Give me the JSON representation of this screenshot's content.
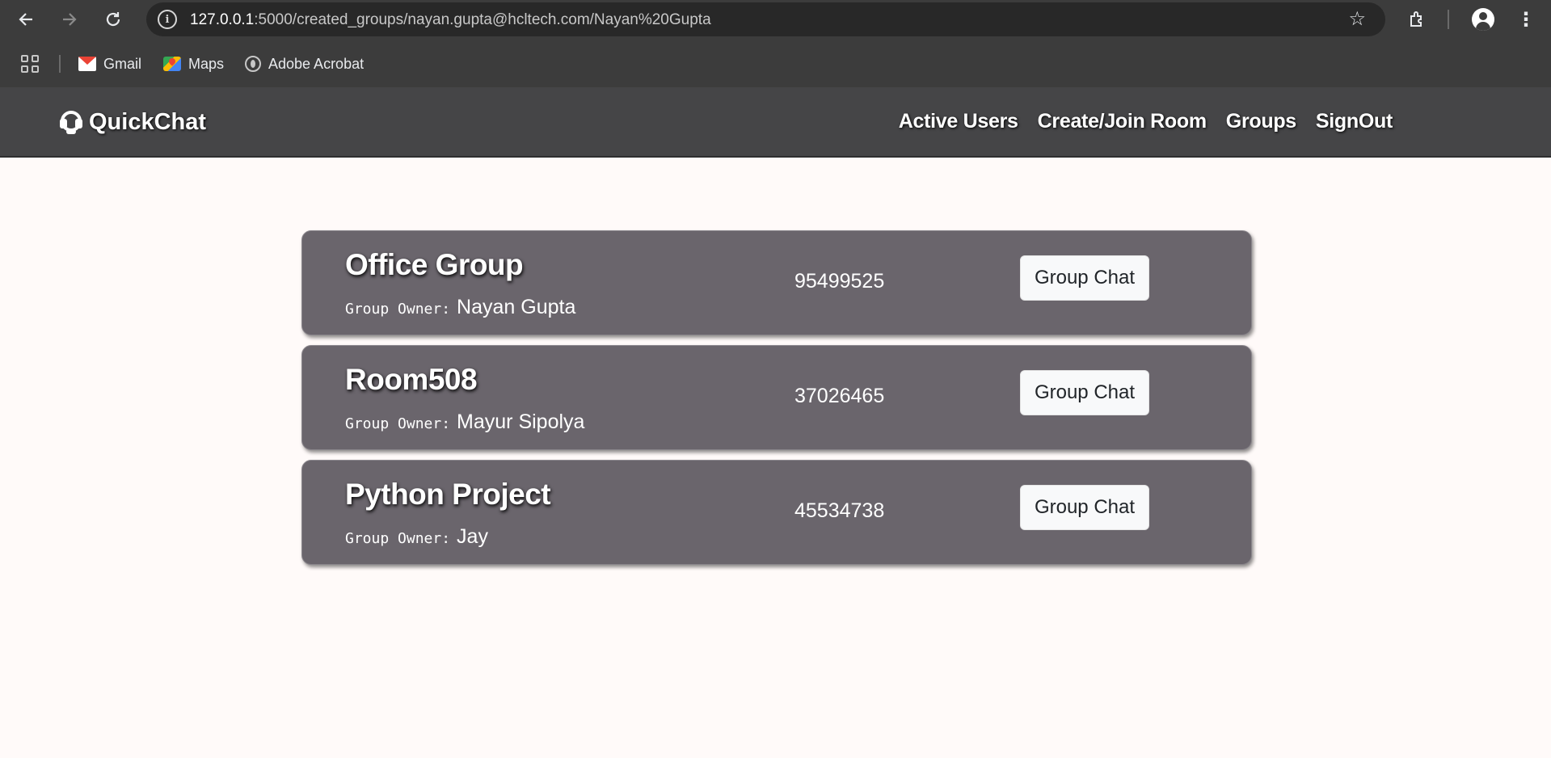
{
  "browser": {
    "url_host": "127.0.0.1",
    "url_rest": ":5000/created_groups/nayan.gupta@hcltech.com/Nayan%20Gupta",
    "bookmarks": [
      {
        "label": "Gmail",
        "icon": "gmail-icon"
      },
      {
        "label": "Maps",
        "icon": "maps-icon"
      },
      {
        "label": "Adobe Acrobat",
        "icon": "globe-icon"
      }
    ]
  },
  "navbar": {
    "brand": "QuickChat",
    "links": [
      "Active Users",
      "Create/Join Room",
      "Groups",
      "SignOut"
    ]
  },
  "groups": [
    {
      "name": "Office Group",
      "owner_label": "Group Owner:",
      "owner": "Nayan Gupta",
      "code": "95499525",
      "button": "Group Chat"
    },
    {
      "name": "Room508",
      "owner_label": "Group Owner:",
      "owner": "Mayur Sipolya",
      "code": "37026465",
      "button": "Group Chat"
    },
    {
      "name": "Python Project",
      "owner_label": "Group Owner:",
      "owner": "Jay",
      "code": "45534738",
      "button": "Group Chat"
    }
  ],
  "colors": {
    "navbar_bg": "#454547",
    "card_bg": "#6a656c",
    "page_bg": "#fffaf9",
    "button_bg": "#f8f9fa"
  }
}
